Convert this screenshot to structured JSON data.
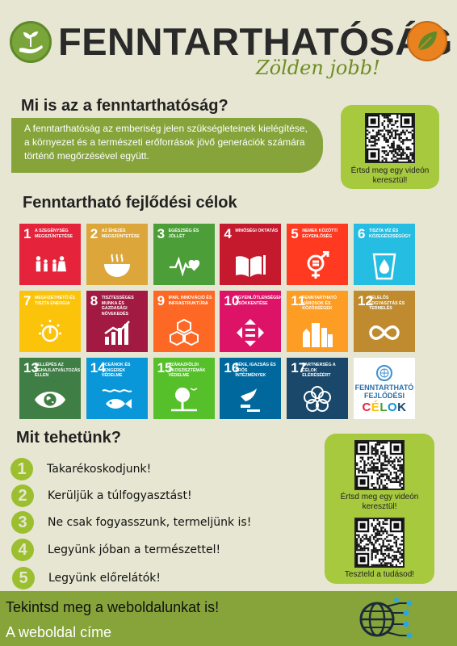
{
  "header": {
    "title": "FENNTARTHATÓSÁG",
    "slogan": "Zölden jobb!",
    "left_logo_icon": "hand-with-sprout-icon",
    "right_logo_icon": "leaf-icon"
  },
  "intro": {
    "heading": "Mi is az a fenntarthatóság?",
    "text": "A fenntarthatóság az emberiség jelen szükségleteinek kielégítése, a környezet és a természeti erőforrások jövő generációk számára történő megőrzésével együtt."
  },
  "qr_video_top": {
    "caption": "Értsd meg egy videón keresztül!",
    "icon": "qr-code-icon"
  },
  "goals": {
    "heading": "Fenntartható fejlődési célok",
    "tiles": [
      {
        "num": "1",
        "label": "A szegénység megszüntetése",
        "color": "#e5243b",
        "icon": "family-icon"
      },
      {
        "num": "2",
        "label": "Az éhezés megszüntetése",
        "color": "#dda63a",
        "icon": "bowl-icon"
      },
      {
        "num": "3",
        "label": "Egészség és jóllét",
        "color": "#4c9f38",
        "icon": "heartbeat-icon"
      },
      {
        "num": "4",
        "label": "Minőségi oktatás",
        "color": "#c5192d",
        "icon": "book-icon"
      },
      {
        "num": "5",
        "label": "Nemek közötti egyenlőség",
        "color": "#ff3a21",
        "icon": "gender-equality-icon"
      },
      {
        "num": "6",
        "label": "Tiszta víz és közegészségügy",
        "color": "#26bde2",
        "icon": "water-drop-icon"
      },
      {
        "num": "7",
        "label": "Megfizethető és tiszta energia",
        "color": "#fcc30b",
        "icon": "power-sun-icon"
      },
      {
        "num": "8",
        "label": "Tisztességes munka és gazdasági növekedés",
        "color": "#a21942",
        "icon": "growth-chart-icon"
      },
      {
        "num": "9",
        "label": "Ipar, innováció és infrastruktúra",
        "color": "#fd6925",
        "icon": "cubes-icon"
      },
      {
        "num": "10",
        "label": "Egyenlőtlenségek csökkentése",
        "color": "#dd1367",
        "icon": "equality-arrows-icon"
      },
      {
        "num": "11",
        "label": "Fenntartható városok és közösségek",
        "color": "#fd9d24",
        "icon": "city-icon"
      },
      {
        "num": "12",
        "label": "Felelős fogyasztás és termelés",
        "color": "#bf8b2e",
        "icon": "infinity-icon"
      },
      {
        "num": "13",
        "label": "Fellépés az éghajlatváltozás ellen",
        "color": "#3f7e44",
        "icon": "eye-globe-icon"
      },
      {
        "num": "14",
        "label": "Óceánok és tengerek védelme",
        "color": "#0a97d9",
        "icon": "fish-icon"
      },
      {
        "num": "15",
        "label": "Szárazföldi ökoszisztémák védelme",
        "color": "#56c02b",
        "icon": "tree-bird-icon"
      },
      {
        "num": "16",
        "label": "Béke, igazság és erős intézmények",
        "color": "#00689d",
        "icon": "dove-gavel-icon"
      },
      {
        "num": "17",
        "label": "Partnerség a célok eléréséért",
        "color": "#19486a",
        "icon": "rings-icon"
      }
    ],
    "sdg_logo": {
      "line1": "FENNTARTHATÓ",
      "line2": "FEJLŐDÉSI",
      "word": "CÉLOK",
      "letter_colors": [
        "#e5243b",
        "#fcc30b",
        "#4c9f38",
        "#0a97d9",
        "#19486a"
      ],
      "icon": "un-emblem-icon"
    }
  },
  "actions": {
    "heading": "Mit tehetünk?",
    "items": [
      {
        "num": "1",
        "text": "Takarékoskodjunk!"
      },
      {
        "num": "2",
        "text": "Kerüljük a túlfogyasztást!"
      },
      {
        "num": "3",
        "text": "Ne csak fogyasszunk, termeljünk is!"
      },
      {
        "num": "4",
        "text": "Legyünk jóban a természettel!"
      },
      {
        "num": "5",
        "text": "Legyünk előrelátók!"
      }
    ]
  },
  "qr_bottom": {
    "video_caption": "Értsd meg egy videón keresztül!",
    "quiz_caption": "Teszteld a tudásod!",
    "icon": "qr-code-icon"
  },
  "footer": {
    "line1": "Tekintsd meg a weboldalunkat is!",
    "line2": "A weboldal címe",
    "icon": "globe-network-icon",
    "bg_color": "#86a43a"
  }
}
